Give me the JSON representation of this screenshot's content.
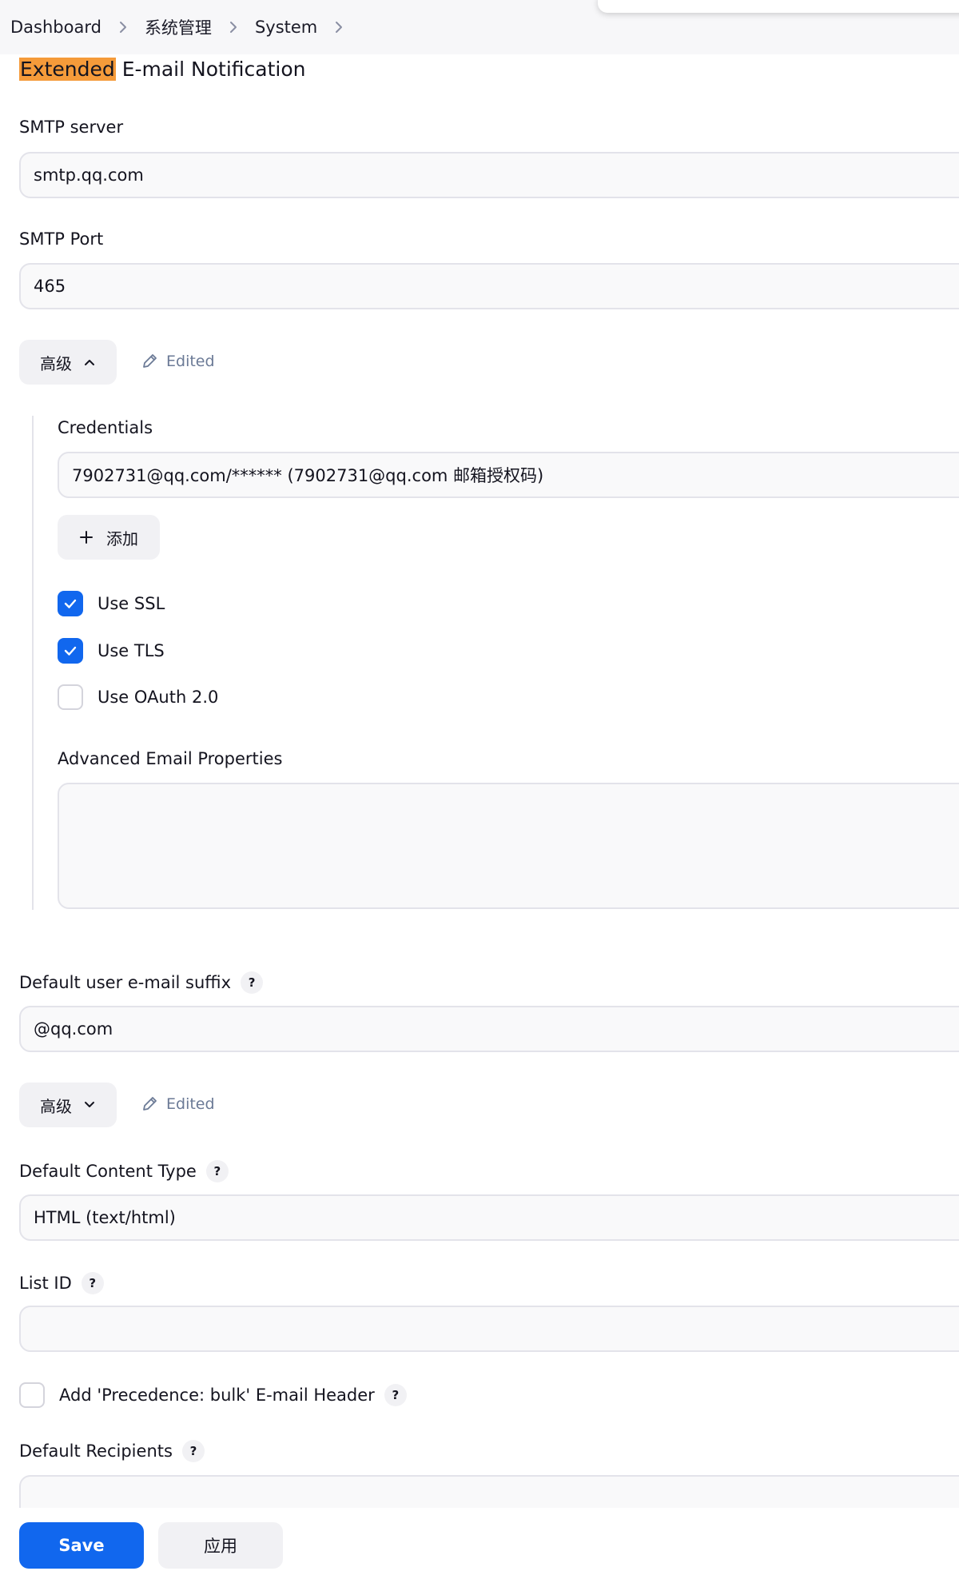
{
  "breadcrumb": {
    "items": [
      "Dashboard",
      "系统管理",
      "System"
    ]
  },
  "section": {
    "title_highlight": "Extended",
    "title_rest": " E-mail Notification"
  },
  "smtp_server": {
    "label": "SMTP server",
    "value": "smtp.qq.com"
  },
  "smtp_port": {
    "label": "SMTP Port",
    "value": "465"
  },
  "advanced_1": {
    "label": "高级",
    "edited": "Edited",
    "expanded": true
  },
  "credentials": {
    "label": "Credentials",
    "value": "7902731@qq.com/****** (7902731@qq.com 邮箱授权码)",
    "add_label": "添加"
  },
  "options": {
    "use_ssl": {
      "label": "Use SSL",
      "checked": true
    },
    "use_tls": {
      "label": "Use TLS",
      "checked": true
    },
    "use_oauth": {
      "label": "Use OAuth 2.0",
      "checked": false
    }
  },
  "advanced_email_properties": {
    "label": "Advanced Email Properties",
    "value": ""
  },
  "default_suffix": {
    "label": "Default user e-mail suffix",
    "value": "@qq.com"
  },
  "advanced_2": {
    "label": "高级",
    "edited": "Edited",
    "expanded": false
  },
  "content_type": {
    "label": "Default Content Type",
    "value": "HTML (text/html)"
  },
  "list_id": {
    "label": "List ID",
    "value": ""
  },
  "precedence": {
    "label": "Add 'Precedence: bulk' E-mail Header",
    "checked": false
  },
  "default_recipients": {
    "label": "Default Recipients",
    "value": ""
  },
  "help_glyph": "?",
  "footer": {
    "save_label": "Save",
    "apply_label": "应用"
  },
  "colors": {
    "accent": "#1167ee",
    "highlight": "#f59b3a",
    "field_bg": "#f9f9fa",
    "field_border": "#e3e3ea",
    "edited_text": "#6b7a96"
  },
  "icons": {
    "separator": "chevron-right-icon",
    "expand_open": "chevron-up-icon",
    "expand_closed": "chevron-down-icon",
    "edited": "pencil-icon",
    "add": "plus-icon",
    "check": "checkmark-icon"
  }
}
